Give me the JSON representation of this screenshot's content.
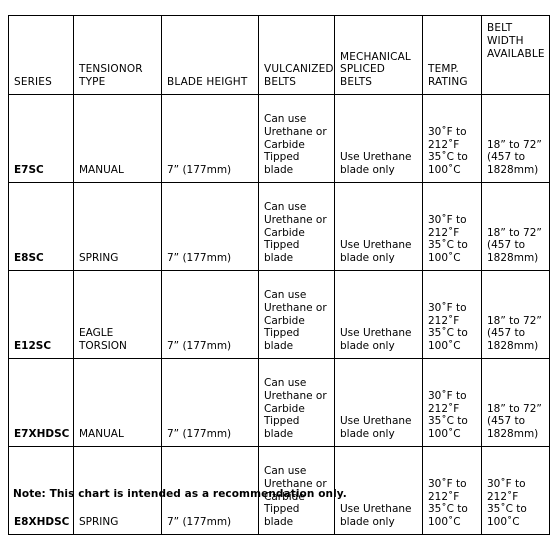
{
  "table": {
    "headers": [
      "SERIES",
      "TENSIONOR TYPE",
      "BLADE HEIGHT",
      "VULCANIZED BELTS",
      "MECHANICAL SPLICED BELTS",
      "TEMP. RATING",
      "BELT WIDTH AVAILABLE"
    ],
    "rows": [
      {
        "series": "E7SC",
        "tensionor_type": "MANUAL",
        "blade_height": "7” (177mm)",
        "vulcanized_belts": "Can use Urethane or Carbide Tipped blade",
        "mechanical_spliced_belts": "Use Urethane blade only",
        "temp_rating": "30˚F to 212˚F 35˚C to 100˚C",
        "belt_width_available": "18” to 72” (457 to 1828mm)"
      },
      {
        "series": "E8SC",
        "tensionor_type": "SPRING",
        "blade_height": "7” (177mm)",
        "vulcanized_belts": "Can use Urethane or Carbide Tipped blade",
        "mechanical_spliced_belts": "Use Urethane blade only",
        "temp_rating": "30˚F to 212˚F 35˚C to 100˚C",
        "belt_width_available": "18” to 72” (457 to 1828mm)"
      },
      {
        "series": "E12SC",
        "tensionor_type": "EAGLE TORSION",
        "blade_height": "7” (177mm)",
        "vulcanized_belts": "Can use Urethane or Carbide Tipped blade",
        "mechanical_spliced_belts": "Use Urethane blade only",
        "temp_rating": "30˚F to 212˚F 35˚C to 100˚C",
        "belt_width_available": "18” to 72” (457 to 1828mm)"
      },
      {
        "series": "E7XHDSC",
        "tensionor_type": "MANUAL",
        "blade_height": "7” (177mm)",
        "vulcanized_belts": "Can use Urethane or Carbide Tipped blade",
        "mechanical_spliced_belts": "Use Urethane blade only",
        "temp_rating": "30˚F to 212˚F 35˚C to 100˚C",
        "belt_width_available": "18” to 72” (457 to 1828mm)"
      },
      {
        "series": "E8XHDSC",
        "tensionor_type": "SPRING",
        "blade_height": "7” (177mm)",
        "vulcanized_belts": "Can use Urethane or Carbide Tipped blade",
        "mechanical_spliced_belts": "Use Urethane blade only",
        "temp_rating": "30˚F to 212˚F 35˚C to 100˚C",
        "belt_width_available": "30˚F to 212˚F 35˚C to 100˚C"
      }
    ]
  },
  "note": "Note: This chart is intended as a recommendation only.",
  "colors": {
    "border": "#000000",
    "text": "#000000",
    "background": "#ffffff"
  }
}
